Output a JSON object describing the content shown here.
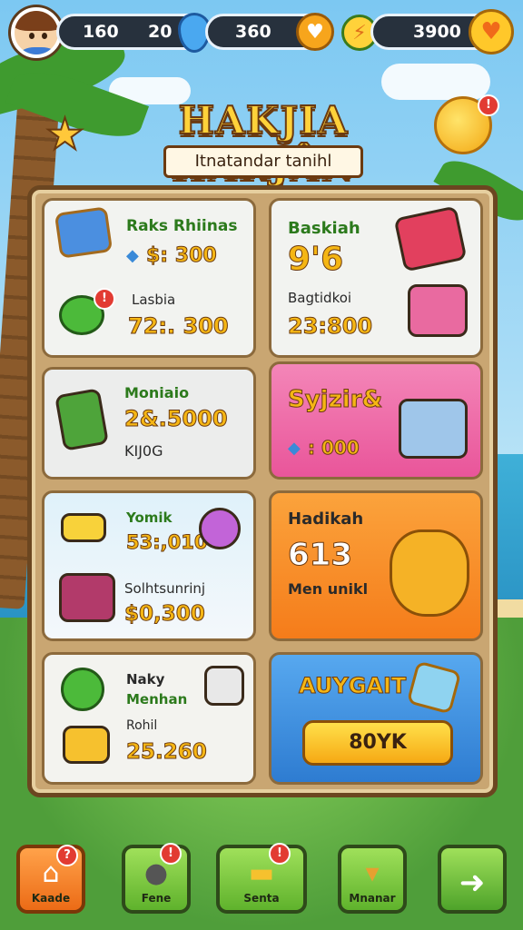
{
  "top_bar": {
    "stat_1": "160",
    "stat_2": "20",
    "gems": "360",
    "coins": "3900",
    "icons": [
      "avatar",
      "gem-icon",
      "heart-icon",
      "energy-icon",
      "heart-icon"
    ]
  },
  "header": {
    "title": "HAKJIA HARJÂN",
    "subtitle": "Itnatandar tanihl",
    "badge_count": "!"
  },
  "cards": {
    "c1": {
      "label": "Raks Rhiinas",
      "price": "$: 300"
    },
    "c2": {
      "label": "Lasbia",
      "price": "72:. 300"
    },
    "c3": {
      "label": "Baskiah",
      "value": "9'6"
    },
    "c4": {
      "label": "Bagtidkoi",
      "price": "23:800"
    },
    "c5": {
      "label": "Moniaio",
      "price": "2&.5000",
      "sub": "KIJ0G"
    },
    "c6": {
      "label": "Syjzir&",
      "price": ": 000"
    },
    "c7": {
      "label": "Yomik",
      "price": "53:,010"
    },
    "c8": {
      "label": "Solhtsunrinj",
      "price": "$0,300"
    },
    "c9": {
      "label": "Hadikah",
      "value": "613",
      "sub": "Men unikl"
    },
    "c10": {
      "label_1": "Naky",
      "label_2": "Menhan",
      "label_3": "Rohil",
      "price": "25.260"
    },
    "c11": {
      "label": "AUYGAIT",
      "button": "80YK"
    }
  },
  "nav": {
    "home": "Kaade",
    "fene": "Fene",
    "senta": "Senta",
    "mnanar": "Mnanar"
  },
  "colors": {
    "accent_gold": "#f5b614",
    "pink_card": "#f16aa7",
    "orange_card": "#f7901e",
    "blue_card": "#3f8fe0",
    "nav_green": "#7ccf3e",
    "nav_orange": "#f08226"
  }
}
